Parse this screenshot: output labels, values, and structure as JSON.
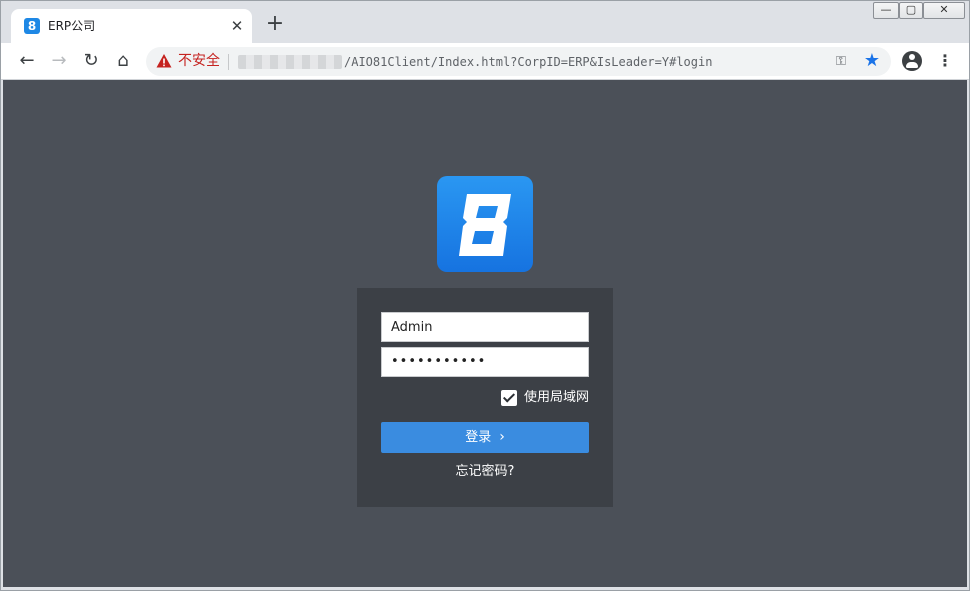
{
  "browser": {
    "tab": {
      "title": "ERP公司",
      "favicon": "8",
      "close": "✕"
    },
    "new_tab": "+",
    "window_controls": {
      "minimize": "—",
      "maximize": "▢",
      "close": "✕"
    },
    "toolbar": {
      "back": "←",
      "forward": "→",
      "reload": "↻",
      "home": "⌂",
      "security_label": "不安全",
      "url_path": "/AIO81Client/Index.html?CorpID=ERP&IsLeader=Y#login",
      "key_icon": "⚿",
      "star_icon": "★",
      "menu_icon": "⋮"
    }
  },
  "login": {
    "username_value": "Admin",
    "password_value": "•••••••••••",
    "lan_label": "使用局域网",
    "lan_checked": true,
    "login_button": "登录",
    "login_chevron": "›",
    "forgot_link": "忘记密码?"
  },
  "colors": {
    "page_bg": "#4b5058",
    "panel_bg": "#3c4046",
    "button": "#3a8ce0",
    "logo": "#1e88e5",
    "security_warning": "#c5221f",
    "star": "#1a73e8"
  }
}
